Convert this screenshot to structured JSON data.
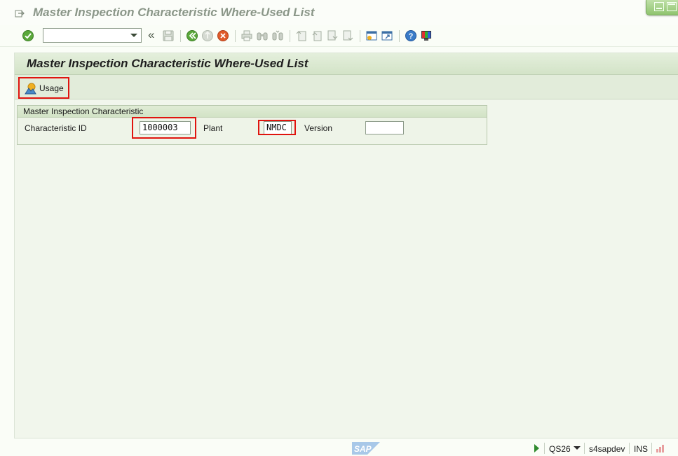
{
  "window": {
    "title": "Master Inspection Characteristic Where-Used List"
  },
  "toolbar": {
    "command_value": "",
    "chevron_label": "«"
  },
  "page": {
    "title": "Master Inspection Characteristic Where-Used List"
  },
  "app_toolbar": {
    "usage_label": "Usage"
  },
  "group": {
    "title": "Master Inspection Characteristic",
    "fields": {
      "characteristic_id": {
        "label": "Characteristic ID",
        "value": "1000003"
      },
      "plant": {
        "label": "Plant",
        "value": "NMDC"
      },
      "version": {
        "label": "Version",
        "value": ""
      }
    }
  },
  "status_bar": {
    "logo_text": "SAP",
    "system": "QS26",
    "server": "s4sapdev",
    "mode": "INS"
  },
  "colors": {
    "highlight": "#e0140f",
    "accent_green": "#8fc46e",
    "header_green": "#d3e3c7"
  }
}
